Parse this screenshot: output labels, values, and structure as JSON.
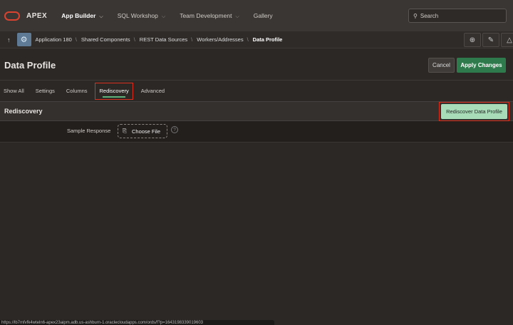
{
  "header": {
    "brand": "APEX",
    "nav": [
      {
        "label": "App Builder"
      },
      {
        "label": "SQL Workshop"
      },
      {
        "label": "Team Development"
      },
      {
        "label": "Gallery"
      }
    ],
    "search_placeholder": "Search"
  },
  "breadcrumb": [
    "Application 180",
    "Shared Components",
    "REST Data Sources",
    "Workers/Addresses",
    "Data Profile"
  ],
  "page": {
    "title": "Data Profile",
    "cancel": "Cancel",
    "apply": "Apply Changes"
  },
  "tabs": [
    "Show All",
    "Settings",
    "Columns",
    "Rediscovery",
    "Advanced"
  ],
  "region": {
    "title": "Rediscovery",
    "button": "Rediscover Data Profile",
    "field_label": "Sample Response",
    "file_button": "Choose File",
    "help": "?"
  },
  "status_url": "https://lb7mfvfk4wteln6-apex23aipm.adb.us-ashburn-1.oraclecloudapps.com/ords/f?p=1643198339019603"
}
